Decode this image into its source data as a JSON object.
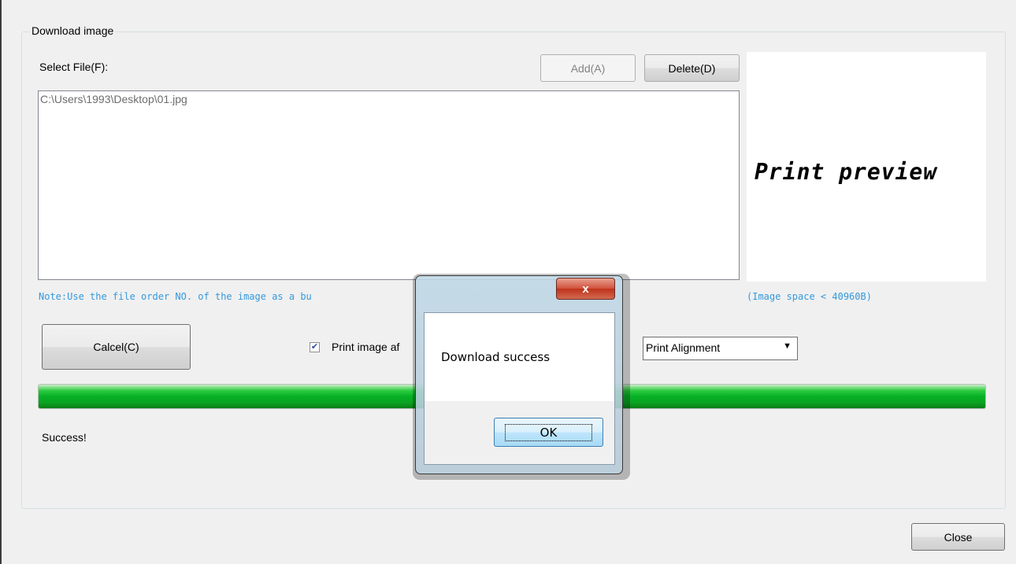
{
  "group": {
    "title": "Download image"
  },
  "file_select": {
    "label": "Select File(F):",
    "add_button": "Add(A)",
    "delete_button": "Delete(D)",
    "files": [
      "C:\\Users\\1993\\Desktop\\01.jpg"
    ]
  },
  "preview": {
    "text": "Print preview"
  },
  "notes": {
    "file_order": "Note:Use the file order NO. of the image as a bu",
    "image_space": "(Image space < 40960B)"
  },
  "actions": {
    "cancel_button": "Calcel(C)",
    "print_checkbox_label": "Print image af",
    "print_checkbox_checked": true,
    "alignment_select": "Print Alignment"
  },
  "progress": {
    "value": 1.0,
    "color": "#06b025"
  },
  "status": {
    "text": "Success!"
  },
  "close_button": "Close",
  "dialog": {
    "close_glyph": "x",
    "message": "Download success",
    "ok_button": "OK"
  }
}
